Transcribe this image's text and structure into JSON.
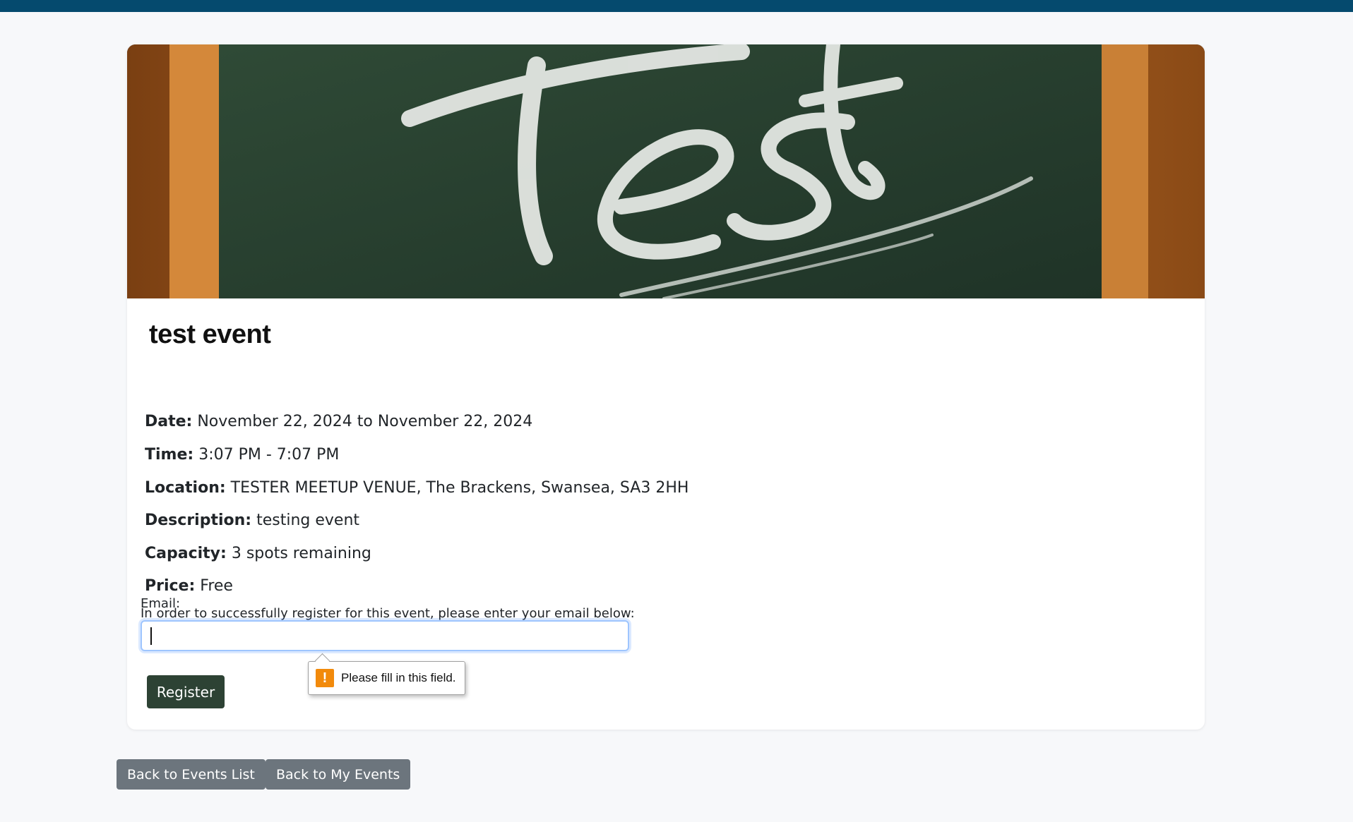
{
  "event": {
    "banner_alt": "Test",
    "title": "test event",
    "details": [
      {
        "label": "Date:",
        "value": "November 22, 2024 to November 22, 2024"
      },
      {
        "label": "Time:",
        "value": "3:07 PM - 7:07 PM"
      },
      {
        "label": "Location:",
        "value": "TESTER MEETUP VENUE, The Brackens, Swansea, SA3 2HH"
      },
      {
        "label": "Description:",
        "value": "testing event"
      },
      {
        "label": "Capacity:",
        "value": "3 spots remaining"
      },
      {
        "label": "Price:",
        "value": "Free"
      }
    ]
  },
  "registration": {
    "intro": "In order to successfully register for this event, please enter your email below:",
    "email_label": "Email:",
    "email_value": "",
    "register_label": "Register",
    "validation_message": "Please fill in this field.",
    "validation_icon": "warning-icon"
  },
  "navigation": {
    "back_to_events": "Back to Events List",
    "back_to_my_events": "Back to My Events"
  },
  "colors": {
    "topbar": "#054a6e",
    "register_button": "#2d4234",
    "secondary_button": "#6c757d",
    "warning": "#f28a0b"
  }
}
